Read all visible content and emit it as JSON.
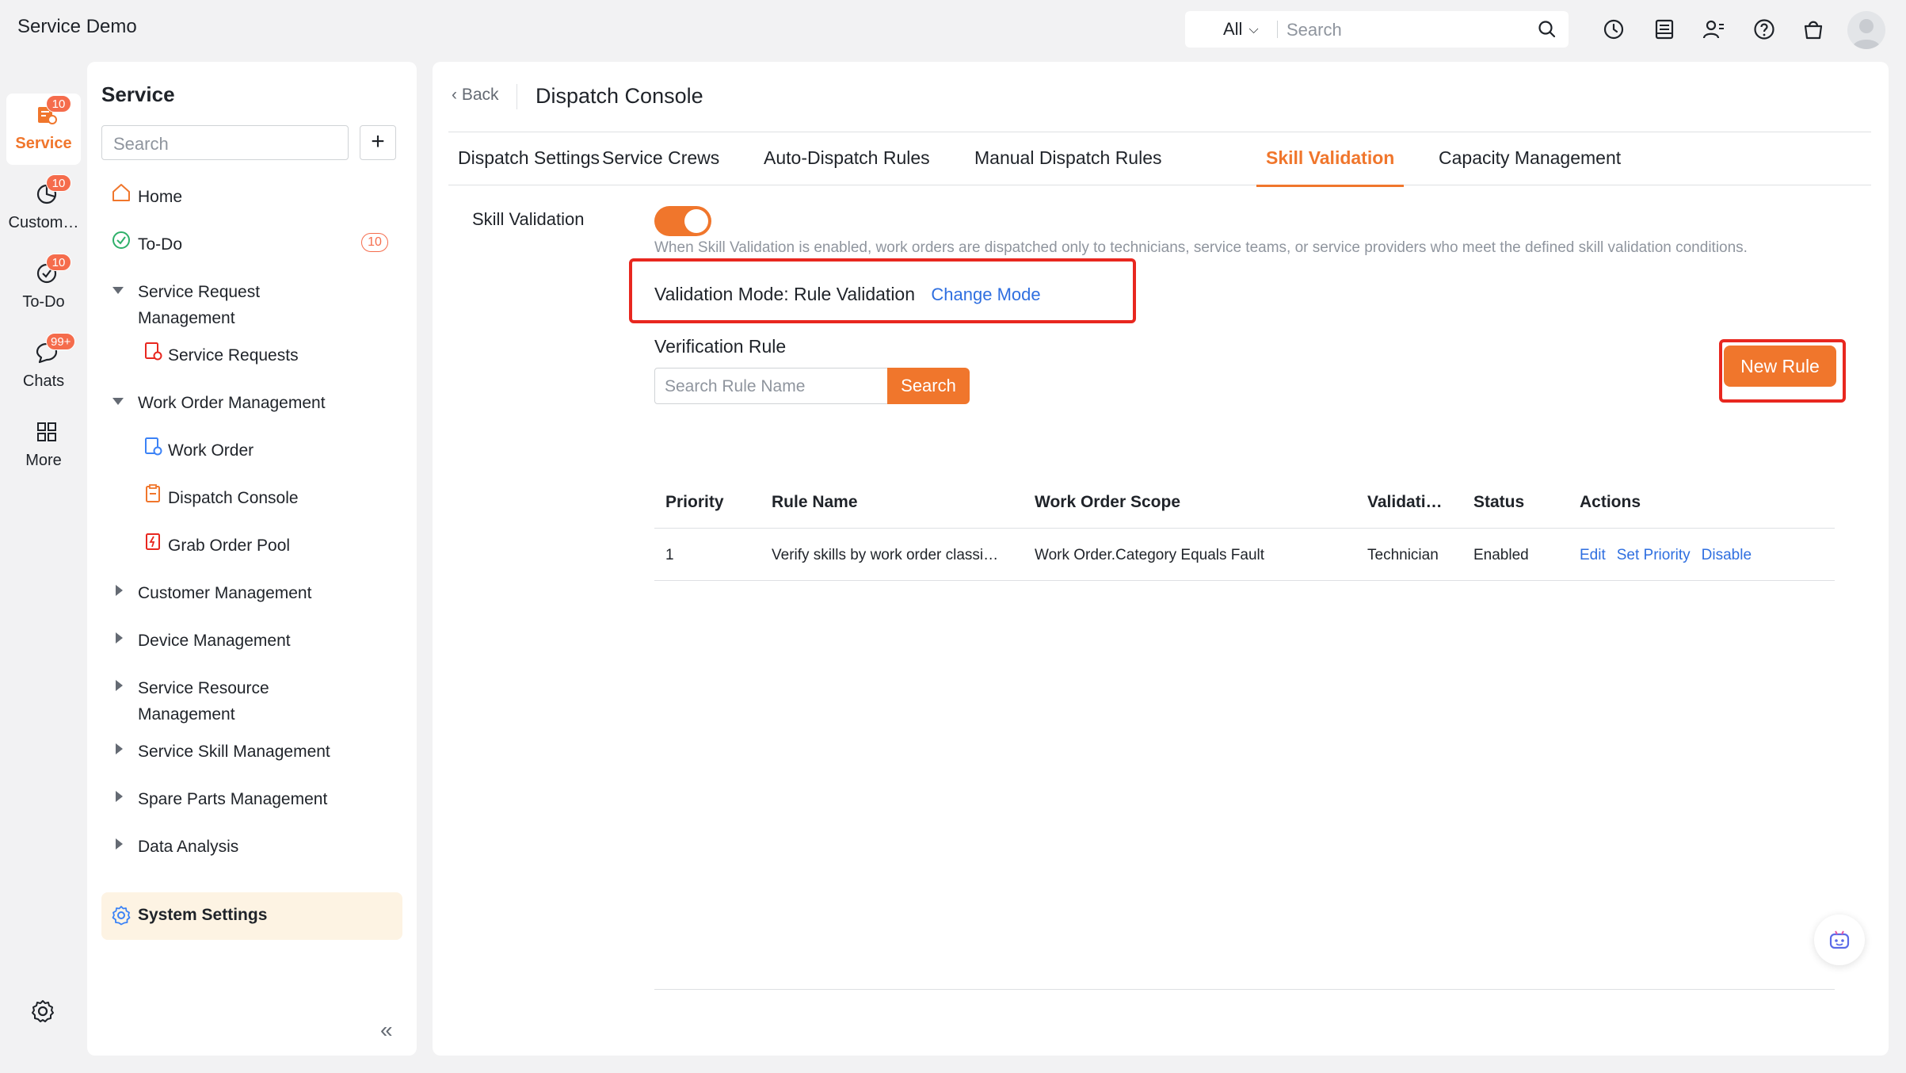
{
  "app": {
    "title": "Service Demo"
  },
  "global_search": {
    "scope": "All",
    "placeholder": "Search"
  },
  "rail": {
    "items": [
      {
        "label": "Service",
        "badge": "10"
      },
      {
        "label": "Custom…",
        "badge": "10"
      },
      {
        "label": "To-Do",
        "badge": "10"
      },
      {
        "label": "Chats",
        "badge": "99+"
      },
      {
        "label": "More"
      }
    ]
  },
  "nav": {
    "title": "Service",
    "search_placeholder": "Search",
    "add_label": "+",
    "items": [
      {
        "label": "Home"
      },
      {
        "label": "To-Do",
        "badge": "10"
      },
      {
        "label": "Service Request",
        "label2": "Management"
      },
      {
        "label": "Service Requests"
      },
      {
        "label": "Work Order Management"
      },
      {
        "label": "Work Order"
      },
      {
        "label": "Dispatch Console"
      },
      {
        "label": "Grab Order Pool"
      },
      {
        "label": "Customer Management"
      },
      {
        "label": "Device Management"
      },
      {
        "label": "Service Resource",
        "label2": "Management"
      },
      {
        "label": "Service Skill Management"
      },
      {
        "label": "Spare Parts Management"
      },
      {
        "label": "Data Analysis"
      },
      {
        "label": "System Settings"
      }
    ],
    "collapse": "«"
  },
  "main": {
    "back": "Back",
    "title": "Dispatch Console",
    "tabs": [
      {
        "label": "Dispatch Settings"
      },
      {
        "label": "Service Crews"
      },
      {
        "label": "Auto-Dispatch Rules"
      },
      {
        "label": "Manual Dispatch Rules"
      },
      {
        "label": "Skill Validation"
      },
      {
        "label": "Capacity Management"
      }
    ],
    "skill_validation": {
      "label": "Skill Validation",
      "enabled": true,
      "description": "When Skill Validation is enabled, work orders are dispatched only to technicians, service teams, or service providers who meet the defined skill validation conditions.",
      "mode_label": "Validation Mode:",
      "mode_value": "Rule Validation",
      "change_mode": "Change Mode"
    },
    "verification": {
      "title": "Verification Rule",
      "search_placeholder": "Search Rule Name",
      "search_button": "Search",
      "new_rule": "New Rule"
    },
    "table": {
      "headers": [
        "Priority",
        "Rule Name",
        "Work Order Scope",
        "Validati…",
        "Status",
        "Actions"
      ],
      "rows": [
        {
          "priority": "1",
          "rule_name": "Verify skills by work order classi…",
          "scope": "Work Order.Category Equals Fault",
          "validation": "Technician",
          "status": "Enabled",
          "actions": [
            "Edit",
            "Set Priority",
            "Disable"
          ]
        }
      ]
    }
  },
  "colors": {
    "accent": "#f0762c",
    "link": "#2f6fe0",
    "highlight": "#e8271f",
    "badge": "#f56c4c"
  }
}
